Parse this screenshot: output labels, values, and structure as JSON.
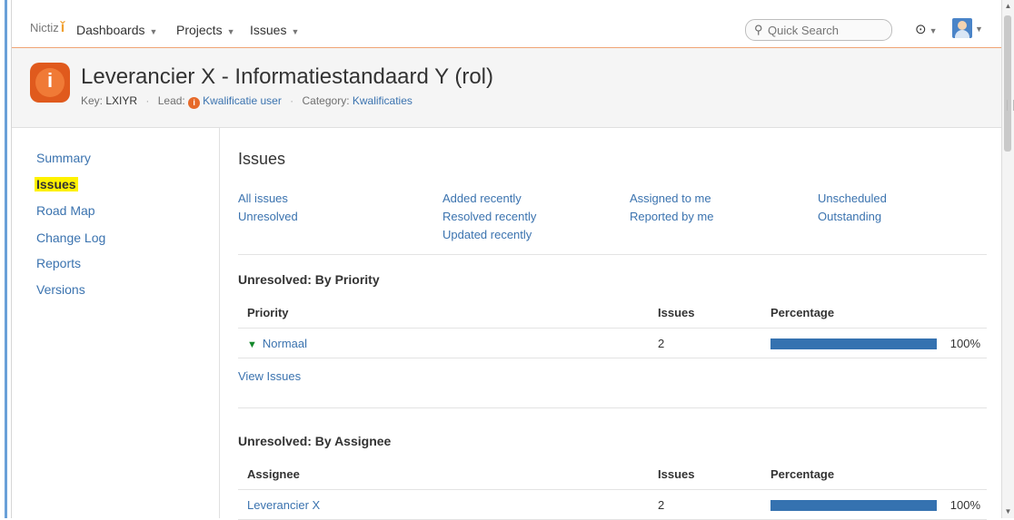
{
  "header": {
    "logo_text": "Nictiz",
    "nav": [
      {
        "label": "Dashboards"
      },
      {
        "label": "Projects"
      },
      {
        "label": "Issues"
      }
    ],
    "search_placeholder": "Quick Search",
    "help_icon": "help-icon",
    "user_icon": "avatar"
  },
  "project": {
    "title": "Leverancier X - Informatiestandaard Y (rol)",
    "key_label": "Key:",
    "key_value": "LXIYR",
    "lead_label": "Lead:",
    "lead_value": "Kwalificatie user",
    "category_label": "Category:",
    "category_value": "Kwalificaties"
  },
  "sidebar": {
    "items": [
      {
        "label": "Summary"
      },
      {
        "label": "Issues"
      },
      {
        "label": "Road Map"
      },
      {
        "label": "Change Log"
      },
      {
        "label": "Reports"
      },
      {
        "label": "Versions"
      }
    ]
  },
  "main": {
    "title": "Issues",
    "filters": [
      [
        "All issues",
        "Unresolved"
      ],
      [
        "Added recently",
        "Resolved recently",
        "Updated recently"
      ],
      [
        "Assigned to me",
        "Reported by me"
      ],
      [
        "Unscheduled",
        "Outstanding"
      ]
    ],
    "by_priority": {
      "title": "Unresolved: By Priority",
      "headers": [
        "Priority",
        "Issues",
        "Percentage"
      ],
      "rows": [
        {
          "name": "Normaal",
          "issues": "2",
          "percent_label": "100%",
          "percent": 100
        }
      ],
      "view_link": "View Issues"
    },
    "by_assignee": {
      "title": "Unresolved: By Assignee",
      "headers": [
        "Assignee",
        "Issues",
        "Percentage"
      ],
      "rows": [
        {
          "name": "Leverancier X",
          "issues": "2",
          "percent_label": "100%",
          "percent": 100
        }
      ]
    }
  },
  "colors": {
    "link": "#3b73af",
    "bar": "#3572b0",
    "highlight": "#fff200",
    "header_accent": "#f0a575"
  }
}
